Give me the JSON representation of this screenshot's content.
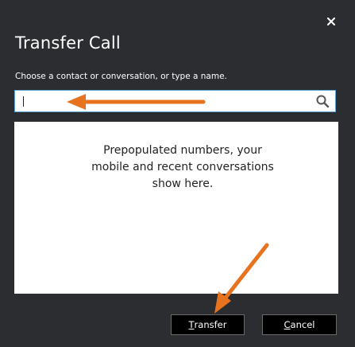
{
  "dialog": {
    "title": "Transfer Call",
    "instruction": "Choose a contact or conversation, or type a name.",
    "close_symbol": "✕"
  },
  "search": {
    "value": "",
    "placeholder": ""
  },
  "results": {
    "empty_message": "Prepopulated numbers, your mobile and recent conversations show here."
  },
  "buttons": {
    "transfer_accel": "T",
    "transfer_rest": "ransfer",
    "cancel_accel": "C",
    "cancel_rest": "ancel"
  },
  "colors": {
    "background": "#2c2d30",
    "panel": "#ffffff",
    "accent_border": "#5fa9d6",
    "annotation_arrow": "#e8731e"
  }
}
